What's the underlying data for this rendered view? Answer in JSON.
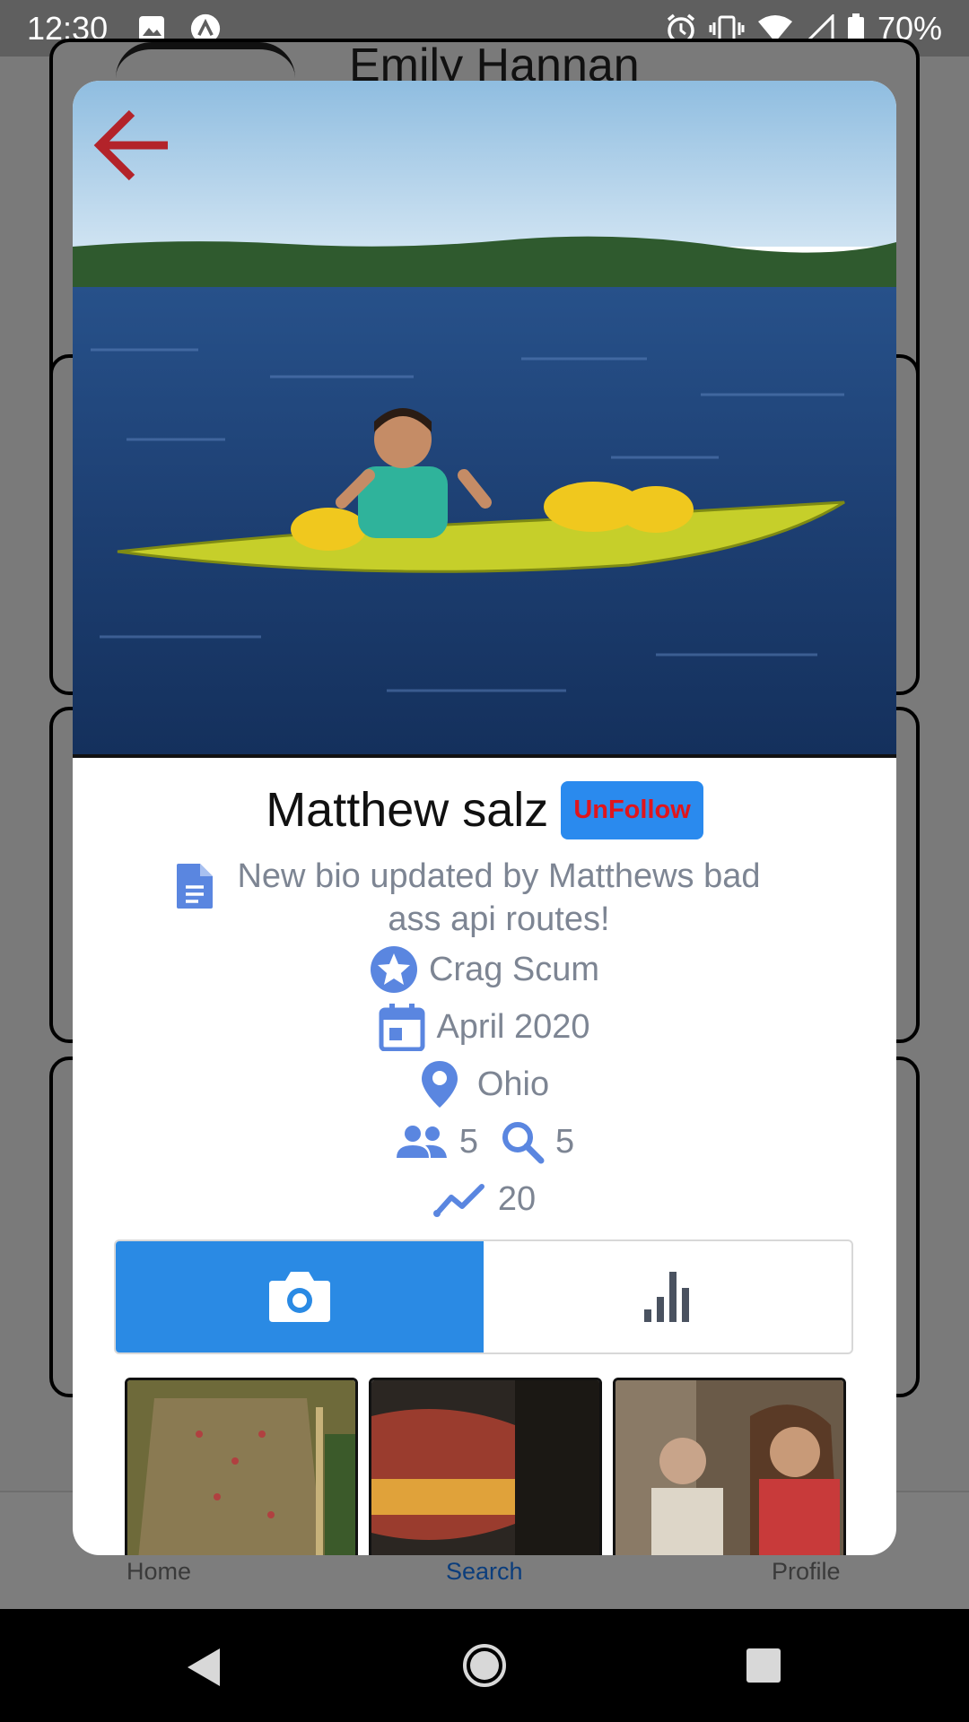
{
  "status_bar": {
    "time": "12:30",
    "battery": "70%",
    "icons": [
      "image-icon",
      "app-icon",
      "alarm-icon",
      "vibrate-icon",
      "wifi-icon",
      "signal-icon",
      "battery-icon"
    ]
  },
  "background": {
    "card_name": "Emily Hannan"
  },
  "bottom_nav": {
    "tabs": [
      {
        "label": "Home"
      },
      {
        "label": "Search"
      },
      {
        "label": "Profile"
      }
    ],
    "active": "Search"
  },
  "profile": {
    "name": "Matthew salz",
    "follow_button": "UnFollow",
    "bio": "New bio updated by Matthews bad ass api routes!",
    "title": "Crag Scum",
    "joined": "April 2020",
    "location": "Ohio",
    "followers": "5",
    "following": "5",
    "score": "20"
  },
  "tabs": [
    {
      "icon": "camera-icon",
      "active": true
    },
    {
      "icon": "bar-chart-icon",
      "active": false
    }
  ],
  "colors": {
    "accent": "#2a8ae4",
    "unfollow_text": "#e0151c",
    "icon_blue": "#5a86e0",
    "muted_text": "#7d8593",
    "back_arrow": "#b3232a"
  }
}
